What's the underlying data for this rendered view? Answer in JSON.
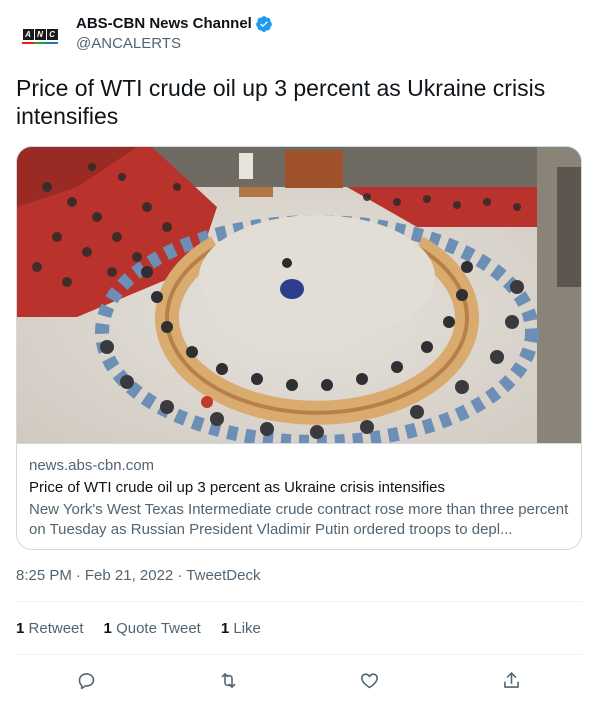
{
  "author": {
    "display_name": "ABS-CBN News Channel",
    "handle": "@ANCALERTS",
    "verified": true,
    "logo_text": "ANC",
    "logo_subtext": "ABS-CBN NEWS CHANNEL"
  },
  "tweet": {
    "text": "Price of WTI crude oil up 3 percent as Ukraine crisis intensifies"
  },
  "card": {
    "domain": "news.abs-cbn.com",
    "title": "Price of WTI crude oil up 3 percent as Ukraine crisis intensifies",
    "description": "New York's West Texas Intermediate crude contract rose more than three percent on Tuesday as Russian President Vladimir Putin ordered troops to depl..."
  },
  "meta": {
    "time": "8:25 PM",
    "date": "Feb 21, 2022",
    "source": "TweetDeck",
    "separator": "·"
  },
  "stats": {
    "retweets_count": "1",
    "retweets_label": "Retweet",
    "quotes_count": "1",
    "quotes_label": "Quote Tweet",
    "likes_count": "1",
    "likes_label": "Like"
  },
  "icons": {
    "reply": "reply-icon",
    "retweet": "retweet-icon",
    "like": "heart-icon",
    "share": "share-icon",
    "verified": "verified-badge-icon"
  },
  "colors": {
    "text_primary": "#0f1419",
    "text_secondary": "#536471",
    "border": "#cfd9de",
    "verified_blue": "#1d9bf0"
  }
}
